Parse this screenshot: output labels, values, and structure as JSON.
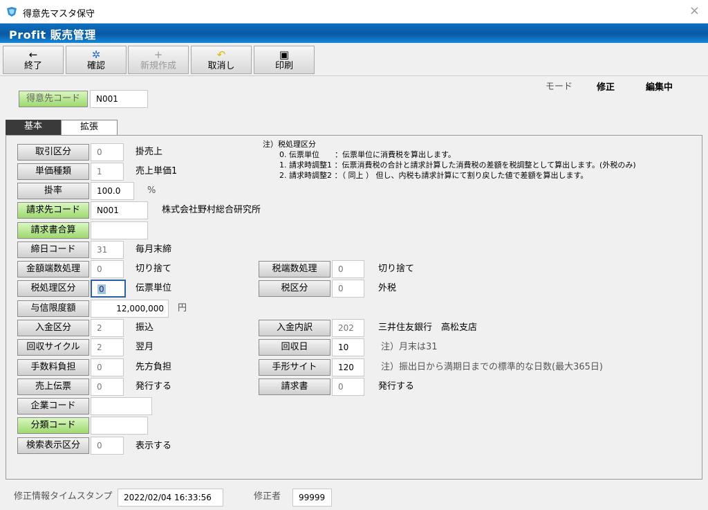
{
  "window": {
    "title": "得意先マスタ保守",
    "close_icon": "×"
  },
  "banner": {
    "text": "Profit 販売管理"
  },
  "toolbar": {
    "buttons": [
      {
        "label": "終了",
        "icon": "←"
      },
      {
        "label": "確認",
        "icon": "✲"
      },
      {
        "label": "新規作成",
        "icon": "+"
      },
      {
        "label": "取消し",
        "icon": "↶"
      },
      {
        "label": "印刷",
        "icon": "▣"
      }
    ]
  },
  "header": {
    "customer_code_label": "得意先コード",
    "customer_code_value": "N001",
    "mode_label": "モード",
    "mode_value": "修正",
    "edit_status": "編集中"
  },
  "tabs": {
    "basic": "基本",
    "extended": "拡張"
  },
  "notes": {
    "title": "注）税処理区分",
    "lines": [
      "0. 伝票単位　　：伝票単位に消費税を算出します。",
      "1. 請求時調整1 ：伝票消費税の合計と請求計算した消費税の差額を税調整として算出します。(外税のみ)",
      "2. 請求時調整2 ：（ 同上 ） 但し、内税も請求計算にて割り戻した値で差額を算出します。"
    ]
  },
  "fields": {
    "torihiki": {
      "label": "取引区分",
      "value": "0",
      "desc": "掛売上"
    },
    "tanka": {
      "label": "単価種類",
      "value": "1",
      "desc": "売上単価1"
    },
    "kakeritsu": {
      "label": "掛率",
      "value": "100.0",
      "unit": "%"
    },
    "seikyusaki": {
      "label": "請求先コード",
      "value": "N001",
      "desc": "株式会社野村総合研究所"
    },
    "seikyusho_gassan": {
      "label": "請求書合算",
      "value": ""
    },
    "shimebi": {
      "label": "締日コード",
      "value": "31",
      "desc": "毎月末締"
    },
    "kingaku_hasu": {
      "label": "金額端数処理",
      "value": "0",
      "desc": "切り捨て"
    },
    "zei_hasu": {
      "label": "税端数処理",
      "value": "0",
      "desc": "切り捨て"
    },
    "zeishori": {
      "label": "税処理区分",
      "value": "0",
      "desc": "伝票単位"
    },
    "zeikubun": {
      "label": "税区分",
      "value": "0",
      "desc": "外税"
    },
    "yoshin": {
      "label": "与信限度額",
      "value": "12,000,000",
      "unit": "円"
    },
    "nyukin_kubun": {
      "label": "入金区分",
      "value": "2",
      "desc": "振込"
    },
    "nyukin_uchiwake": {
      "label": "入金内訳",
      "value": "202",
      "desc": "三井住友銀行　高松支店"
    },
    "kaishu_cycle": {
      "label": "回収サイクル",
      "value": "2",
      "desc": "翌月"
    },
    "kaishubi": {
      "label": "回収日",
      "value": "10",
      "note": "注）月末は31"
    },
    "tesuryo": {
      "label": "手数料負担",
      "value": "0",
      "desc": "先方負担"
    },
    "tegata_site": {
      "label": "手形サイト",
      "value": "120",
      "note": "注）振出日から満期日までの標準的な日数(最大365日)"
    },
    "uriage_denpyo": {
      "label": "売上伝票",
      "value": "0",
      "desc": "発行する"
    },
    "seikyusho": {
      "label": "請求書",
      "value": "0",
      "desc": "発行する"
    },
    "kigyo_code": {
      "label": "企業コード",
      "value": ""
    },
    "bunrui_code": {
      "label": "分類コード",
      "value": ""
    },
    "kensaku": {
      "label": "検索表示区分",
      "value": "0",
      "desc": "表示する"
    }
  },
  "status": {
    "timestamp_label": "修正情報タイムスタンプ",
    "timestamp_value": "2022/02/04 16:33:56",
    "modifier_label": "修正者",
    "modifier_value": "99999"
  }
}
